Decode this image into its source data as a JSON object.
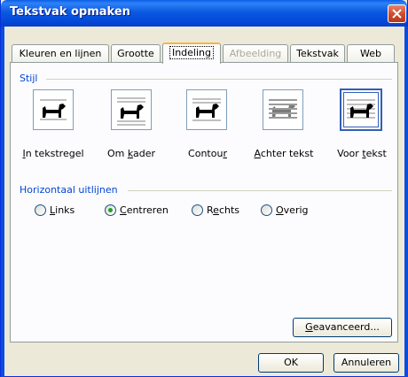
{
  "window": {
    "title": "Tekstvak opmaken"
  },
  "tabs": [
    {
      "label": "Kleuren en lijnen",
      "state": "normal"
    },
    {
      "label": "Grootte",
      "state": "normal"
    },
    {
      "label": "Indeling",
      "state": "active"
    },
    {
      "label": "Afbeelding",
      "state": "disabled"
    },
    {
      "label": "Tekstvak",
      "state": "normal"
    },
    {
      "label": "Web",
      "state": "normal"
    }
  ],
  "style_group": {
    "title": "Stijl",
    "options": [
      {
        "label_pre": "",
        "label_key": "I",
        "label_post": "n tekstregel",
        "icon": "dog-in-line-icon"
      },
      {
        "label_pre": "Om ",
        "label_key": "k",
        "label_post": "ader",
        "icon": "dog-square-wrap-icon"
      },
      {
        "label_pre": "Contou",
        "label_key": "r",
        "label_post": "",
        "icon": "dog-tight-wrap-icon"
      },
      {
        "label_pre": "",
        "label_key": "A",
        "label_post": "chter tekst",
        "icon": "dog-behind-text-icon"
      },
      {
        "label_pre": "Voor ",
        "label_key": "t",
        "label_post": "ekst",
        "icon": "dog-in-front-of-text-icon",
        "selected": true
      }
    ]
  },
  "align_group": {
    "title": "Horizontaal uitlijnen",
    "options": [
      {
        "label_pre": "",
        "label_key": "L",
        "label_post": "inks",
        "checked": false
      },
      {
        "label_pre": "",
        "label_key": "C",
        "label_post": "entreren",
        "checked": true
      },
      {
        "label_pre": "R",
        "label_key": "e",
        "label_post": "chts",
        "checked": false
      },
      {
        "label_pre": "",
        "label_key": "O",
        "label_post": "verig",
        "checked": false
      }
    ]
  },
  "buttons": {
    "advanced_pre": "",
    "advanced_key": "G",
    "advanced_post": "eavanceerd...",
    "ok": "OK",
    "cancel": "Annuleren"
  },
  "colors": {
    "title_bar": "#0a5ee6",
    "group_title": "#0046d5",
    "dialog_bg": "#ece9d8",
    "radio_dot": "#21a121"
  }
}
